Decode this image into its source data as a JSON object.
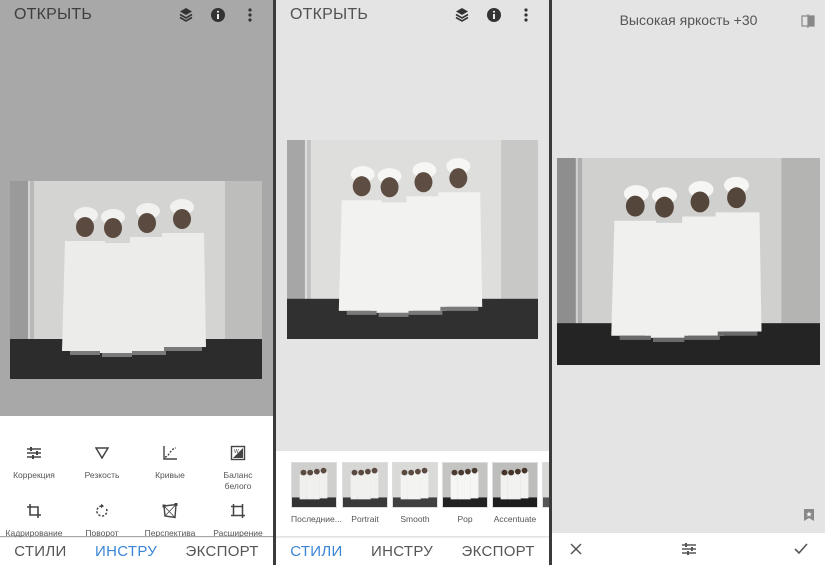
{
  "panel1": {
    "title": "ОТКРЫТЬ",
    "tools": [
      {
        "label": "Коррекция",
        "icon": "tune-sliders-icon"
      },
      {
        "label": "Резкость",
        "icon": "triangle-details-icon"
      },
      {
        "label": "Кривые",
        "icon": "curves-icon"
      },
      {
        "label": "Баланс белого",
        "icon": "white-balance-icon"
      },
      {
        "label": "Кадрирование",
        "icon": "crop-icon"
      },
      {
        "label": "Поворот",
        "icon": "rotate-icon"
      },
      {
        "label": "Перспектива",
        "icon": "perspective-icon"
      },
      {
        "label": "Расширение",
        "icon": "expand-icon"
      }
    ],
    "nav": [
      "СТИЛИ",
      "ИНСТРУ",
      "ЭКСПОРТ"
    ],
    "active_tab": "ИНСТРУ"
  },
  "panel2": {
    "title": "ОТКРЫТЬ",
    "looks": [
      "Последние...",
      "Portrait",
      "Smooth",
      "Pop",
      "Accentuate",
      "Fa"
    ],
    "nav": [
      "СТИЛИ",
      "ИНСТРУ",
      "ЭКСПОРТ"
    ],
    "active_tab": "СТИЛИ"
  },
  "panel3": {
    "adjust_label": "Высокая яркость +30"
  },
  "colors": {
    "accent": "#3b85d6"
  }
}
